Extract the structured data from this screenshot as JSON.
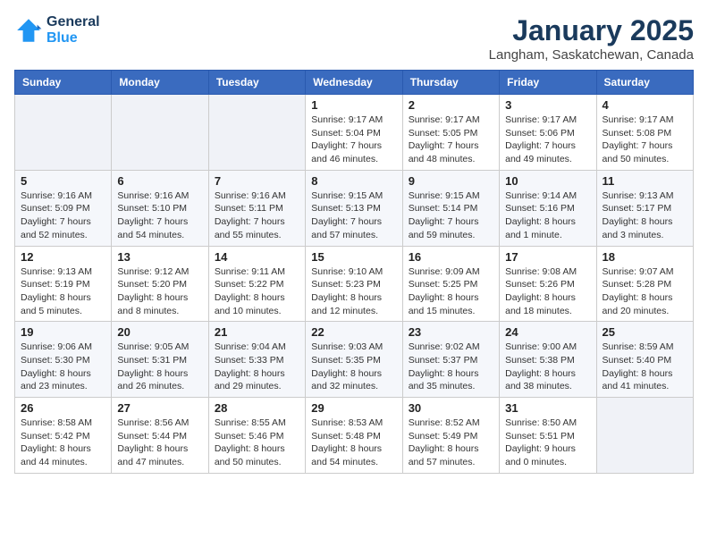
{
  "logo": {
    "line1": "General",
    "line2": "Blue"
  },
  "title": "January 2025",
  "subtitle": "Langham, Saskatchewan, Canada",
  "weekdays": [
    "Sunday",
    "Monday",
    "Tuesday",
    "Wednesday",
    "Thursday",
    "Friday",
    "Saturday"
  ],
  "weeks": [
    [
      {
        "day": "",
        "info": ""
      },
      {
        "day": "",
        "info": ""
      },
      {
        "day": "",
        "info": ""
      },
      {
        "day": "1",
        "info": "Sunrise: 9:17 AM\nSunset: 5:04 PM\nDaylight: 7 hours and 46 minutes."
      },
      {
        "day": "2",
        "info": "Sunrise: 9:17 AM\nSunset: 5:05 PM\nDaylight: 7 hours and 48 minutes."
      },
      {
        "day": "3",
        "info": "Sunrise: 9:17 AM\nSunset: 5:06 PM\nDaylight: 7 hours and 49 minutes."
      },
      {
        "day": "4",
        "info": "Sunrise: 9:17 AM\nSunset: 5:08 PM\nDaylight: 7 hours and 50 minutes."
      }
    ],
    [
      {
        "day": "5",
        "info": "Sunrise: 9:16 AM\nSunset: 5:09 PM\nDaylight: 7 hours and 52 minutes."
      },
      {
        "day": "6",
        "info": "Sunrise: 9:16 AM\nSunset: 5:10 PM\nDaylight: 7 hours and 54 minutes."
      },
      {
        "day": "7",
        "info": "Sunrise: 9:16 AM\nSunset: 5:11 PM\nDaylight: 7 hours and 55 minutes."
      },
      {
        "day": "8",
        "info": "Sunrise: 9:15 AM\nSunset: 5:13 PM\nDaylight: 7 hours and 57 minutes."
      },
      {
        "day": "9",
        "info": "Sunrise: 9:15 AM\nSunset: 5:14 PM\nDaylight: 7 hours and 59 minutes."
      },
      {
        "day": "10",
        "info": "Sunrise: 9:14 AM\nSunset: 5:16 PM\nDaylight: 8 hours and 1 minute."
      },
      {
        "day": "11",
        "info": "Sunrise: 9:13 AM\nSunset: 5:17 PM\nDaylight: 8 hours and 3 minutes."
      }
    ],
    [
      {
        "day": "12",
        "info": "Sunrise: 9:13 AM\nSunset: 5:19 PM\nDaylight: 8 hours and 5 minutes."
      },
      {
        "day": "13",
        "info": "Sunrise: 9:12 AM\nSunset: 5:20 PM\nDaylight: 8 hours and 8 minutes."
      },
      {
        "day": "14",
        "info": "Sunrise: 9:11 AM\nSunset: 5:22 PM\nDaylight: 8 hours and 10 minutes."
      },
      {
        "day": "15",
        "info": "Sunrise: 9:10 AM\nSunset: 5:23 PM\nDaylight: 8 hours and 12 minutes."
      },
      {
        "day": "16",
        "info": "Sunrise: 9:09 AM\nSunset: 5:25 PM\nDaylight: 8 hours and 15 minutes."
      },
      {
        "day": "17",
        "info": "Sunrise: 9:08 AM\nSunset: 5:26 PM\nDaylight: 8 hours and 18 minutes."
      },
      {
        "day": "18",
        "info": "Sunrise: 9:07 AM\nSunset: 5:28 PM\nDaylight: 8 hours and 20 minutes."
      }
    ],
    [
      {
        "day": "19",
        "info": "Sunrise: 9:06 AM\nSunset: 5:30 PM\nDaylight: 8 hours and 23 minutes."
      },
      {
        "day": "20",
        "info": "Sunrise: 9:05 AM\nSunset: 5:31 PM\nDaylight: 8 hours and 26 minutes."
      },
      {
        "day": "21",
        "info": "Sunrise: 9:04 AM\nSunset: 5:33 PM\nDaylight: 8 hours and 29 minutes."
      },
      {
        "day": "22",
        "info": "Sunrise: 9:03 AM\nSunset: 5:35 PM\nDaylight: 8 hours and 32 minutes."
      },
      {
        "day": "23",
        "info": "Sunrise: 9:02 AM\nSunset: 5:37 PM\nDaylight: 8 hours and 35 minutes."
      },
      {
        "day": "24",
        "info": "Sunrise: 9:00 AM\nSunset: 5:38 PM\nDaylight: 8 hours and 38 minutes."
      },
      {
        "day": "25",
        "info": "Sunrise: 8:59 AM\nSunset: 5:40 PM\nDaylight: 8 hours and 41 minutes."
      }
    ],
    [
      {
        "day": "26",
        "info": "Sunrise: 8:58 AM\nSunset: 5:42 PM\nDaylight: 8 hours and 44 minutes."
      },
      {
        "day": "27",
        "info": "Sunrise: 8:56 AM\nSunset: 5:44 PM\nDaylight: 8 hours and 47 minutes."
      },
      {
        "day": "28",
        "info": "Sunrise: 8:55 AM\nSunset: 5:46 PM\nDaylight: 8 hours and 50 minutes."
      },
      {
        "day": "29",
        "info": "Sunrise: 8:53 AM\nSunset: 5:48 PM\nDaylight: 8 hours and 54 minutes."
      },
      {
        "day": "30",
        "info": "Sunrise: 8:52 AM\nSunset: 5:49 PM\nDaylight: 8 hours and 57 minutes."
      },
      {
        "day": "31",
        "info": "Sunrise: 8:50 AM\nSunset: 5:51 PM\nDaylight: 9 hours and 0 minutes."
      },
      {
        "day": "",
        "info": ""
      }
    ]
  ]
}
